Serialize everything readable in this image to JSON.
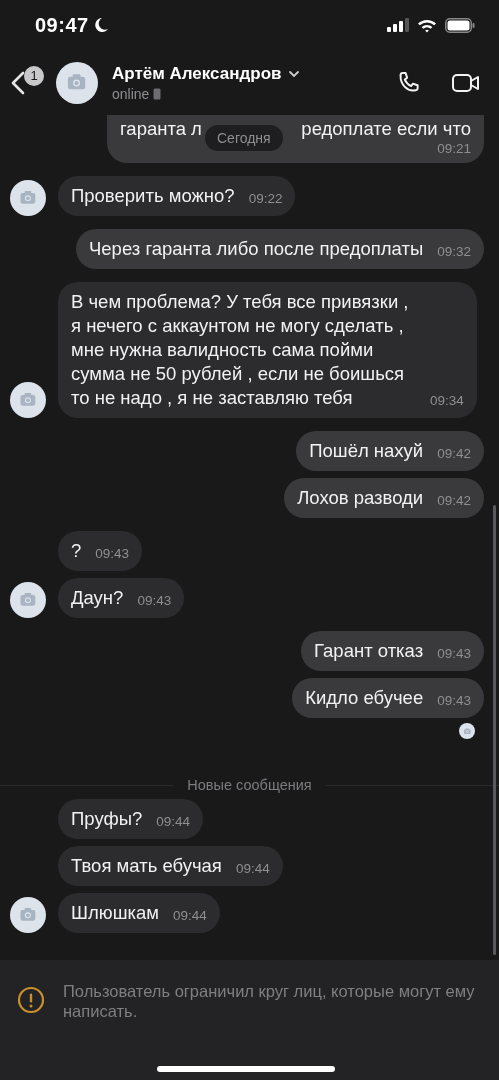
{
  "status_bar": {
    "time": "09:47",
    "do_not_disturb": true
  },
  "header": {
    "back_badge": "1",
    "name": "Артём Александров",
    "status": "online"
  },
  "date_pill": "Сегодня",
  "messages": [
    {
      "kind": "partial",
      "outgoing": true,
      "fragments": [
        "гаранта л",
        "редоплате если что"
      ],
      "time": "09:21",
      "avatar": false,
      "read_avatar": false
    },
    {
      "kind": "text",
      "outgoing": false,
      "text": "Проверить можно?",
      "time": "09:22",
      "avatar": true,
      "read_avatar": false
    },
    {
      "kind": "text",
      "outgoing": true,
      "text": "Через гаранта либо после предоплаты",
      "time": "09:32",
      "avatar": false,
      "read_avatar": false
    },
    {
      "kind": "text",
      "outgoing": false,
      "text": "В чем проблема? У тебя все привязки , я нечего с аккаунтом не могу сделать , мне нужна валидность сама пойми сумма не 50 рублей , если не боишься то не надо , я не заставляю тебя",
      "time": "09:34",
      "avatar": true,
      "read_avatar": false
    },
    {
      "kind": "text",
      "outgoing": true,
      "text": "Пошёл нахуй",
      "time": "09:42",
      "avatar": false,
      "read_avatar": false
    },
    {
      "kind": "text",
      "outgoing": true,
      "text": "Лохов разводи",
      "time": "09:42",
      "avatar": false,
      "read_avatar": false
    },
    {
      "kind": "text",
      "outgoing": false,
      "text": "?",
      "time": "09:43",
      "avatar": false,
      "read_avatar": false
    },
    {
      "kind": "text",
      "outgoing": false,
      "text": "Даун?",
      "time": "09:43",
      "avatar": true,
      "read_avatar": false
    },
    {
      "kind": "text",
      "outgoing": true,
      "text": "Гарант отказ",
      "time": "09:43",
      "avatar": false,
      "read_avatar": false
    },
    {
      "kind": "text",
      "outgoing": true,
      "text": "Кидло ебучее",
      "time": "09:43",
      "avatar": false,
      "read_avatar": true
    },
    {
      "kind": "divider",
      "text": "Новые сообщения"
    },
    {
      "kind": "text",
      "outgoing": false,
      "text": "Пруфы?",
      "time": "09:44",
      "avatar": false,
      "read_avatar": false
    },
    {
      "kind": "text",
      "outgoing": false,
      "text": "Твоя мать ебучая",
      "time": "09:44",
      "avatar": false,
      "read_avatar": false
    },
    {
      "kind": "text",
      "outgoing": false,
      "text": "Шлюшкам",
      "time": "09:44",
      "avatar": true,
      "read_avatar": false
    }
  ],
  "notice": {
    "text": "Пользователь ограничил круг лиц, которые могут ему написать."
  }
}
